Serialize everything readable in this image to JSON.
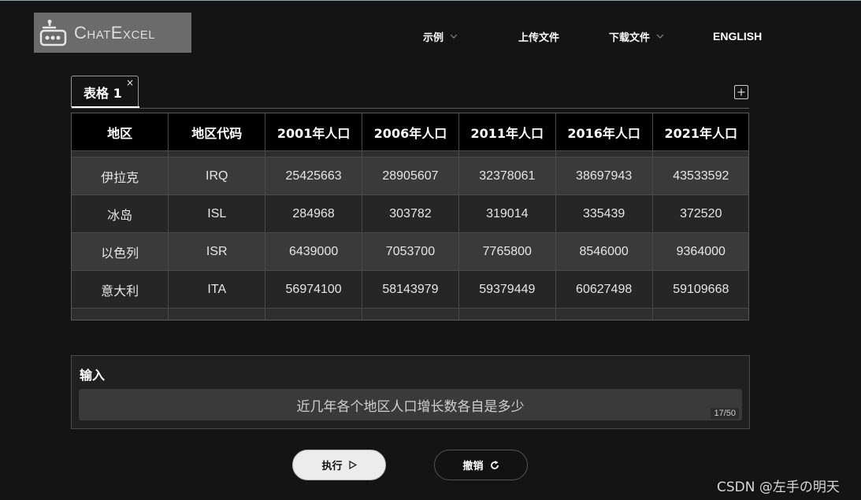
{
  "app": {
    "logo_text": "ChatExcel"
  },
  "nav": {
    "example_label": "示例",
    "upload_label": "上传文件",
    "download_label": "下载文件",
    "english_label": "ENGLISH"
  },
  "tabs": [
    {
      "label": "表格 1",
      "close": "×"
    }
  ],
  "table": {
    "columns": [
      "地区",
      "地区代码",
      "2001年人口",
      "2006年人口",
      "2011年人口",
      "2016年人口",
      "2021年人口"
    ],
    "rows": [
      [
        "伊拉克",
        "IRQ",
        "25425663",
        "28905607",
        "32378061",
        "38697943",
        "43533592"
      ],
      [
        "冰岛",
        "ISL",
        "284968",
        "303782",
        "319014",
        "335439",
        "372520"
      ],
      [
        "以色列",
        "ISR",
        "6439000",
        "7053700",
        "7765800",
        "8546000",
        "9364000"
      ],
      [
        "意大利",
        "ITA",
        "56974100",
        "58143979",
        "59379449",
        "60627498",
        "59109668"
      ]
    ]
  },
  "input": {
    "label": "输入",
    "value": "近几年各个地区人口增长数各自是多少",
    "counter": "17/50"
  },
  "buttons": {
    "run_label": "执行",
    "undo_label": "撤销"
  },
  "watermark": "CSDN @左手の明天"
}
